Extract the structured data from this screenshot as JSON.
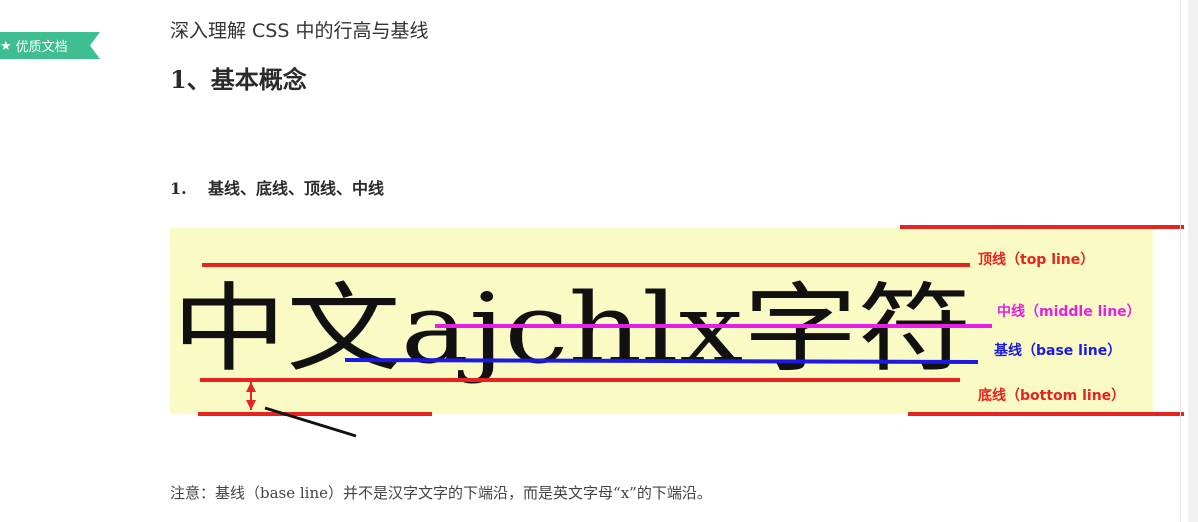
{
  "badge": {
    "label": "优质文档",
    "icon": "star-icon"
  },
  "document": {
    "title": "深入理解 CSS 中的行高与基线",
    "heading1": "1、基本概念",
    "heading2_number": "1.",
    "heading2_text": "基线、底线、顶线、中线",
    "note": "注意：基线（base line）并不是汉字文字的下端沿，而是英文字母“x”的下端沿。"
  },
  "figure": {
    "sample_text": "中文ajchlx字符",
    "labels": {
      "top_line": "顶线（top line）",
      "middle_line": "中线（middle line）",
      "base_line": "基线（base line）",
      "bottom_line": "底线（bottom line）"
    },
    "colors": {
      "background": "#fafac4",
      "top_line": "#e8221e",
      "middle_line": "#e81ee6",
      "base_line": "#1a1ae0",
      "bottom_line": "#e8221e"
    }
  }
}
